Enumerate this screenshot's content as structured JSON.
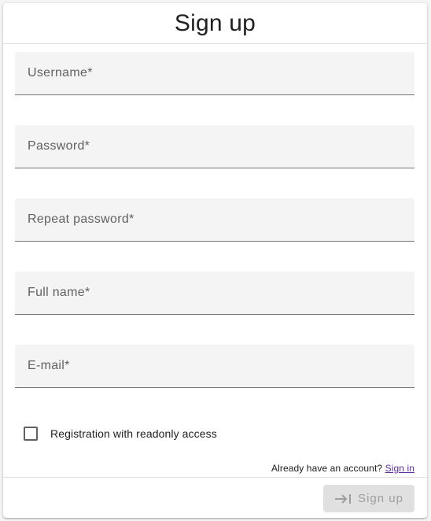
{
  "header": {
    "title": "Sign up"
  },
  "form": {
    "fields": [
      {
        "placeholder": "Username*",
        "value": ""
      },
      {
        "placeholder": "Password*",
        "value": ""
      },
      {
        "placeholder": "Repeat password*",
        "value": ""
      },
      {
        "placeholder": "Full name*",
        "value": ""
      },
      {
        "placeholder": "E-mail*",
        "value": ""
      }
    ],
    "readonly_checkbox": {
      "label": "Registration with readonly access",
      "checked": false
    },
    "account_prompt": "Already have an account?",
    "signin_link": "Sign in",
    "submit": {
      "label": "Sign up",
      "icon": "login-arrow-icon",
      "disabled": true
    }
  },
  "colors": {
    "link": "#5b2c9f",
    "field_bg": "#f4f4f4",
    "disabled_button_bg": "#e0e0e0",
    "disabled_button_text": "#9e9e9e"
  }
}
